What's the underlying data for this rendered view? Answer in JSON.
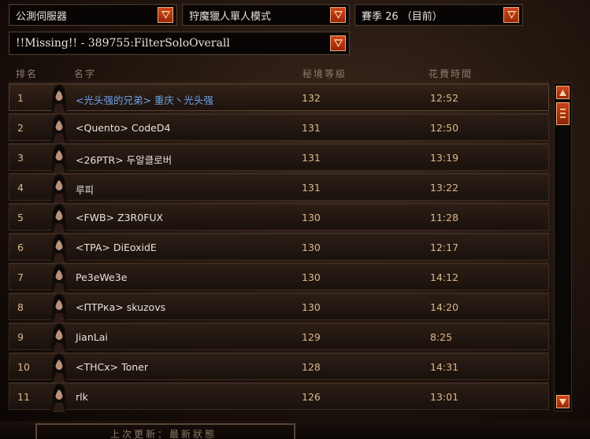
{
  "filters": {
    "server": "公測伺服器",
    "mode": "狩魔獵人單人模式",
    "season": "賽季 26 （目前）",
    "filter": "!!Missing!! - 389755:FilterSoloOverall"
  },
  "columns": {
    "rank": "排名",
    "name": "名字",
    "level": "秘境等級",
    "time": "花費時間"
  },
  "rows": [
    {
      "rank": "1",
      "name": "<光头强的兄弟> 重庆丶光头强",
      "level": "132",
      "time": "12:52",
      "highlight": true
    },
    {
      "rank": "2",
      "name": "<Quento> CodeD4",
      "level": "131",
      "time": "12:50"
    },
    {
      "rank": "3",
      "name": "<26PTR> 두알클로버",
      "level": "131",
      "time": "13:19"
    },
    {
      "rank": "4",
      "name": "루피",
      "level": "131",
      "time": "13:22"
    },
    {
      "rank": "5",
      "name": "<FWB> Z3R0FUX",
      "level": "130",
      "time": "11:28"
    },
    {
      "rank": "6",
      "name": "<TPA> DiEoxidE",
      "level": "130",
      "time": "12:17"
    },
    {
      "rank": "7",
      "name": "Pe3eWe3e",
      "level": "130",
      "time": "14:12"
    },
    {
      "rank": "8",
      "name": "<ПТРка> skuzovs",
      "level": "130",
      "time": "14:20"
    },
    {
      "rank": "9",
      "name": "JianLai",
      "level": "129",
      "time": "8:25"
    },
    {
      "rank": "10",
      "name": "<THCx> Toner",
      "level": "128",
      "time": "14:31"
    },
    {
      "rank": "11",
      "name": "rlk",
      "level": "126",
      "time": "13:01"
    }
  ],
  "footer": {
    "last_updated": "上次更新：最新狀態"
  },
  "colors": {
    "accent_button": "#c13a14",
    "highlight_name": "#6ea2e6",
    "value_text": "#d9b98b"
  },
  "icons": {
    "dropdown": "chevron-down-icon",
    "scroll_up": "arrow-up-icon",
    "scroll_down": "arrow-down-icon",
    "portrait": "demon-hunter-portrait-icon"
  }
}
